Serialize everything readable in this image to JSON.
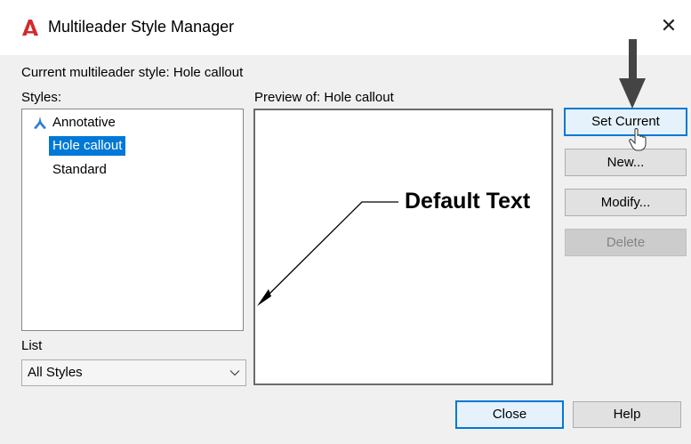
{
  "window": {
    "title": "Multileader Style Manager",
    "close_glyph": "✕",
    "icon": "autocad-a-icon",
    "accent_color": "#0078d7",
    "icon_color": "#d4292b"
  },
  "current_style_label": "Current multileader style: Hole callout",
  "styles": {
    "label": "Styles:",
    "items": [
      {
        "label": "Annotative",
        "icon": "annotative-icon",
        "selected": false
      },
      {
        "label": "Hole callout",
        "selected": true
      },
      {
        "label": "Standard",
        "selected": false
      }
    ]
  },
  "list_filter": {
    "label": "List",
    "value": "All Styles"
  },
  "preview": {
    "label": "Preview of: Hole callout",
    "sample_text": "Default Text"
  },
  "buttons": {
    "set_current": "Set Current",
    "new": "New...",
    "modify": "Modify...",
    "delete": "Delete",
    "close": "Close",
    "help": "Help"
  }
}
